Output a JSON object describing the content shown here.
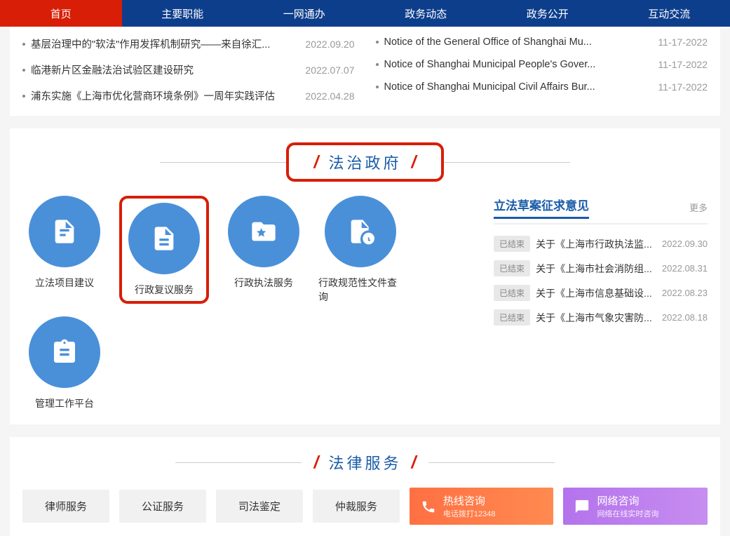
{
  "nav": {
    "items": [
      "首页",
      "主要职能",
      "一网通办",
      "政务动态",
      "政务公开",
      "互动交流"
    ]
  },
  "news": {
    "left": [
      {
        "title": "基层治理中的\"软法\"作用发挥机制研究——来自徐汇...",
        "date": "2022.09.20"
      },
      {
        "title": "临港新片区金融法治试验区建设研究",
        "date": "2022.07.07"
      },
      {
        "title": "浦东实施《上海市优化营商环境条例》一周年实践评估",
        "date": "2022.04.28"
      }
    ],
    "right": [
      {
        "title": "Notice of the General Office of Shanghai Mu...",
        "date": "11-17-2022"
      },
      {
        "title": "Notice of Shanghai Municipal People's Gover...",
        "date": "11-17-2022"
      },
      {
        "title": "Notice of Shanghai Municipal Civil Affairs Bur...",
        "date": "11-17-2022"
      }
    ]
  },
  "gov": {
    "heading": "法治政府",
    "icons": [
      {
        "label": "立法项目建议"
      },
      {
        "label": "行政复议服务"
      },
      {
        "label": "行政执法服务"
      },
      {
        "label": "行政规范性文件查询"
      },
      {
        "label": "管理工作平台"
      }
    ],
    "consult": {
      "title": "立法草案征求意见",
      "more": "更多",
      "items": [
        {
          "status": "已结束",
          "text": "关于《上海市行政执法监...",
          "date": "2022.09.30"
        },
        {
          "status": "已结束",
          "text": "关于《上海市社会消防组...",
          "date": "2022.08.31"
        },
        {
          "status": "已结束",
          "text": "关于《上海市信息基础设...",
          "date": "2022.08.23"
        },
        {
          "status": "已结束",
          "text": "关于《上海市气象灾害防...",
          "date": "2022.08.18"
        }
      ]
    }
  },
  "legal": {
    "heading": "法律服务",
    "buttons": [
      "律师服务",
      "公证服务",
      "司法鉴定",
      "仲裁服务"
    ],
    "hotline": {
      "main": "热线咨询",
      "sub": "电话拨打12348"
    },
    "netline": {
      "main": "网络咨询",
      "sub": "网络在线实时咨询"
    }
  }
}
